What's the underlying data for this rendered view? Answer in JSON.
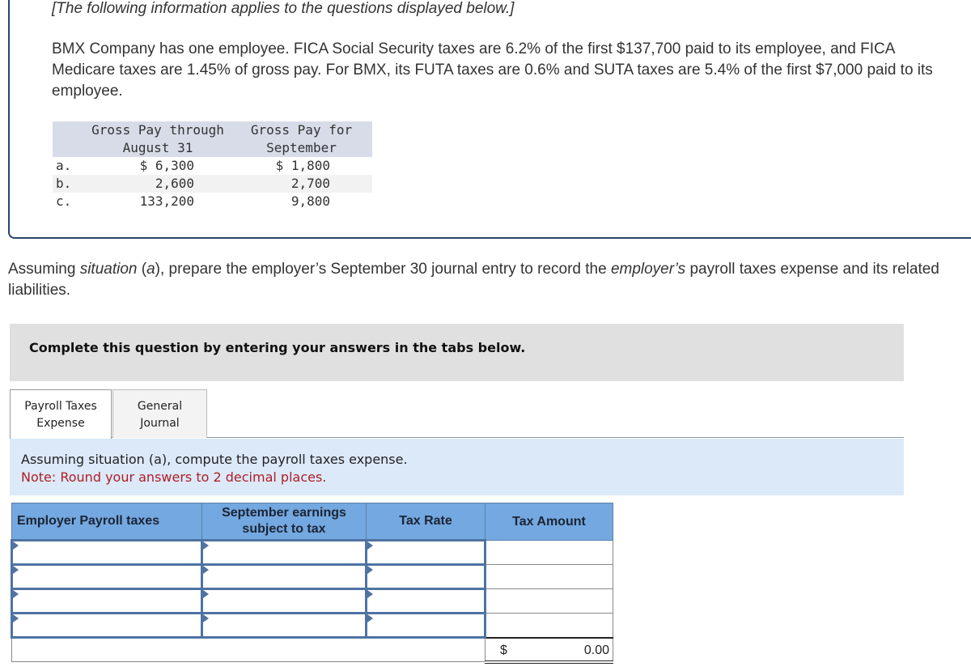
{
  "info": {
    "intro": "[The following information applies to the questions displayed below.]",
    "problem": "BMX Company has one employee. FICA Social Security taxes are 6.2% of the first $137,700 paid to its employee, and FICA Medicare taxes are 1.45% of gross pay. For BMX, its FUTA taxes are 0.6% and SUTA taxes are 5.4% of the first $7,000 paid to its employee.",
    "gross_table": {
      "headers": [
        "",
        "Gross Pay through\nAugust 31",
        "Gross Pay for\nSeptember"
      ],
      "rows": [
        {
          "label": "a.",
          "august": "$ 6,300",
          "september": "$ 1,800"
        },
        {
          "label": "b.",
          "august": "2,600",
          "september": "2,700"
        },
        {
          "label": "c.",
          "august": "133,200",
          "september": "9,800"
        }
      ]
    }
  },
  "instruction": {
    "part1": "Assuming ",
    "italic1": "situation",
    "part2": " (",
    "italic2": "a",
    "part3": "), prepare the employer’s September 30 journal entry to record the ",
    "italic3": "employer’s",
    "part4": " payroll taxes expense and its related liabilities."
  },
  "banner": "Complete this question by entering your answers in the tabs below.",
  "tabs": [
    {
      "line1": "Payroll Taxes",
      "line2": "Expense",
      "active": true
    },
    {
      "line1": "General",
      "line2": "Journal",
      "active": false
    }
  ],
  "panel": {
    "question": "Assuming situation (a), compute the payroll taxes expense.",
    "note": "Note: Round your answers to 2 decimal places."
  },
  "tax_table": {
    "headers": {
      "col1": "Employer Payroll taxes",
      "col2_line1": "September earnings",
      "col2_line2": "subject to tax",
      "col3": "Tax Rate",
      "col4": "Tax Amount"
    },
    "rows": [
      {
        "tax": "",
        "earnings": "",
        "rate": "",
        "amount": ""
      },
      {
        "tax": "",
        "earnings": "",
        "rate": "",
        "amount": ""
      },
      {
        "tax": "",
        "earnings": "",
        "rate": "",
        "amount": ""
      },
      {
        "tax": "",
        "earnings": "",
        "rate": "",
        "amount": ""
      }
    ],
    "total": {
      "currency": "$",
      "value": "0.00"
    }
  },
  "colors": {
    "header_blue": "#74a8e0",
    "panel_blue": "#dbe9f8",
    "note_red": "#b01e24",
    "banner_gray": "#e0e0e0"
  }
}
